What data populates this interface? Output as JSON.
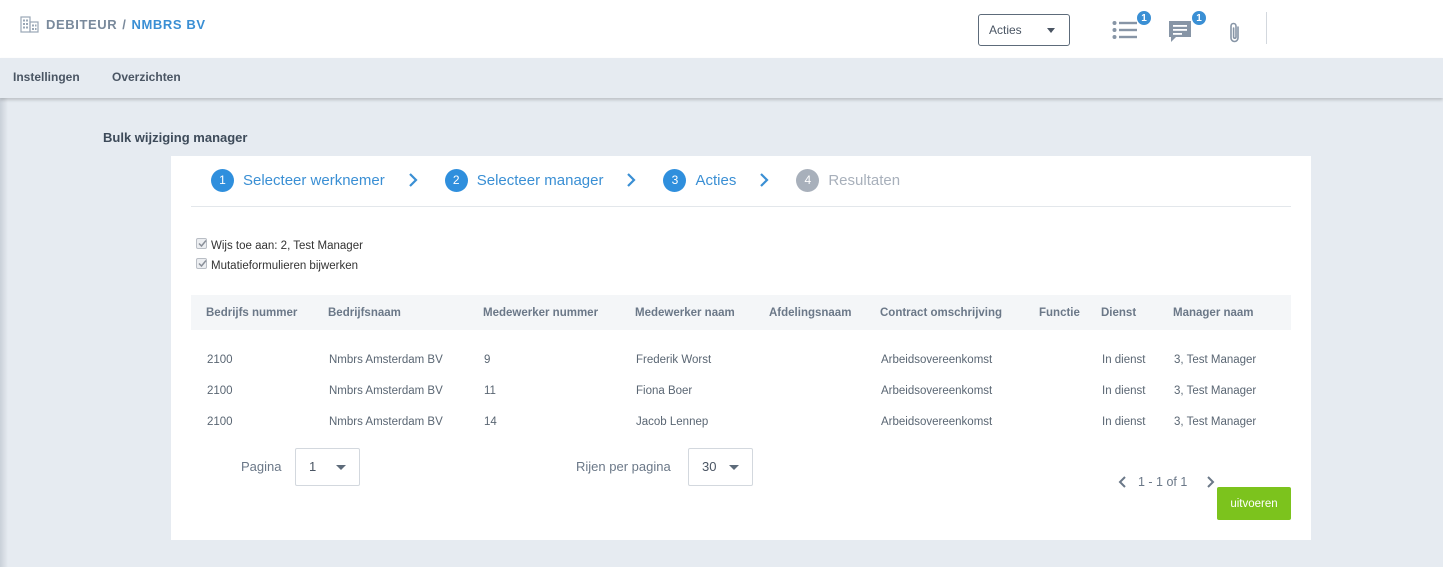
{
  "header": {
    "breadcrumb_part1": "DEBITEUR",
    "breadcrumb_separator": "/",
    "breadcrumb_part2": "NMBRS BV",
    "actions_label": "Acties",
    "tasks_badge": "1",
    "messages_badge": "1",
    "icons": [
      "building-icon",
      "task-list-icon",
      "message-icon",
      "paperclip-icon"
    ]
  },
  "nav": {
    "items": [
      "Instellingen",
      "Overzichten"
    ]
  },
  "page": {
    "title": "Bulk wijziging manager"
  },
  "wizard": {
    "steps": [
      {
        "number": "1",
        "label": "Selecteer werknemer",
        "active": true
      },
      {
        "number": "2",
        "label": "Selecteer manager",
        "active": true
      },
      {
        "number": "3",
        "label": "Acties",
        "active": true
      },
      {
        "number": "4",
        "label": "Resultaten",
        "active": false
      }
    ]
  },
  "options": [
    {
      "label": "Wijs toe aan: 2, Test Manager",
      "checked": true
    },
    {
      "label": "Mutatieformulieren bijwerken",
      "checked": true
    }
  ],
  "table": {
    "columns": [
      "Bedrijfs nummer",
      "Bedrijfsnaam",
      "Medewerker nummer",
      "Medewerker naam",
      "Afdelingsnaam",
      "Contract omschrijving",
      "Functie",
      "Dienst",
      "Manager naam"
    ],
    "rows": [
      [
        "2100",
        "Nmbrs Amsterdam BV",
        "9",
        "Frederik Worst",
        "",
        "Arbeidsovereenkomst",
        "",
        "In dienst",
        "3, Test Manager"
      ],
      [
        "2100",
        "Nmbrs Amsterdam BV",
        "11",
        "Fiona Boer",
        "",
        "Arbeidsovereenkomst",
        "",
        "In dienst",
        "3, Test Manager"
      ],
      [
        "2100",
        "Nmbrs Amsterdam BV",
        "14",
        "Jacob Lennep",
        "",
        "Arbeidsovereenkomst",
        "",
        "In dienst",
        "3, Test Manager"
      ]
    ]
  },
  "pagination": {
    "page_label": "Pagina",
    "page_value": "1",
    "rows_label": "Rijen per pagina",
    "rows_value": "30",
    "range": "1 - 1 of 1"
  },
  "actions": {
    "run_label": "uitvoeren"
  },
  "colors": {
    "accent": "#2f8fdd",
    "run_button": "#7cc31d",
    "disabled_step": "#a8b0bb"
  }
}
